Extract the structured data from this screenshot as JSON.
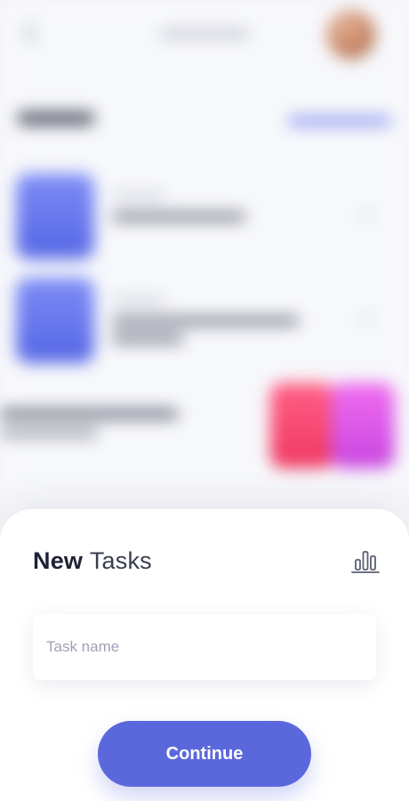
{
  "colors": {
    "accent": "#5b68dc",
    "background": "#f7f8fb",
    "sheet": "#ffffff",
    "title_text": "#1f2235",
    "placeholder_text": "#9fa2b4"
  },
  "background_screen": {
    "avatar_icon": "user-avatar",
    "back_icon": "chevron-left-icon"
  },
  "sheet": {
    "title_bold": "New",
    "title_light": "Tasks",
    "stats_icon": "bar-chart-icon"
  },
  "task_input": {
    "placeholder": "Task name",
    "value": ""
  },
  "continue_button": {
    "label": "Continue"
  }
}
